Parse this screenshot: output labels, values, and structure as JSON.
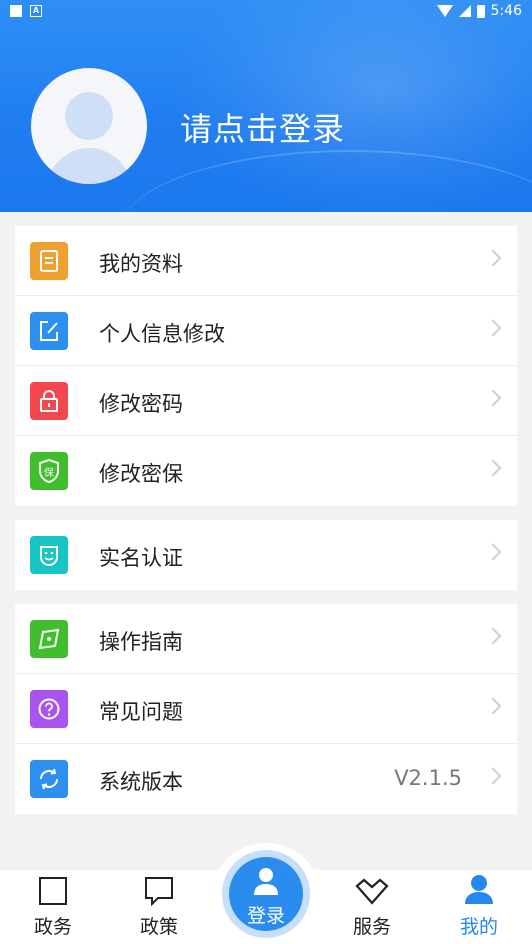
{
  "status_bar": {
    "time": "5:46"
  },
  "profile": {
    "login_prompt": "请点击登录"
  },
  "groups": [
    {
      "items": [
        {
          "label": "我的资料",
          "icon": "profile-doc-icon",
          "color": "#f0a030"
        },
        {
          "label": "个人信息修改",
          "icon": "edit-icon",
          "color": "#2d8ff0"
        },
        {
          "label": "修改密码",
          "icon": "lock-icon",
          "color": "#f2474f"
        },
        {
          "label": "修改密保",
          "icon": "shield-icon",
          "color": "#3fbf2c",
          "badge": "保"
        }
      ]
    },
    {
      "items": [
        {
          "label": "实名认证",
          "icon": "face-id-icon",
          "color": "#18c4c4"
        }
      ]
    },
    {
      "items": [
        {
          "label": "操作指南",
          "icon": "compass-icon",
          "color": "#3fbf2c"
        },
        {
          "label": "常见问题",
          "icon": "question-icon",
          "color": "#a855f0"
        },
        {
          "label": "系统版本",
          "icon": "refresh-icon",
          "color": "#2d8ff0",
          "value": "V2.1.5"
        }
      ]
    }
  ],
  "tabs": [
    {
      "label": "政务",
      "icon": "square-icon"
    },
    {
      "label": "政策",
      "icon": "message-icon"
    },
    {
      "label": "登录",
      "icon": "user-icon"
    },
    {
      "label": "服务",
      "icon": "heart-icon"
    },
    {
      "label": "我的",
      "icon": "person-icon",
      "active": true
    }
  ],
  "colors": {
    "primary": "#2588ee",
    "header": "#1f7df0",
    "background": "#f2f2f2"
  }
}
